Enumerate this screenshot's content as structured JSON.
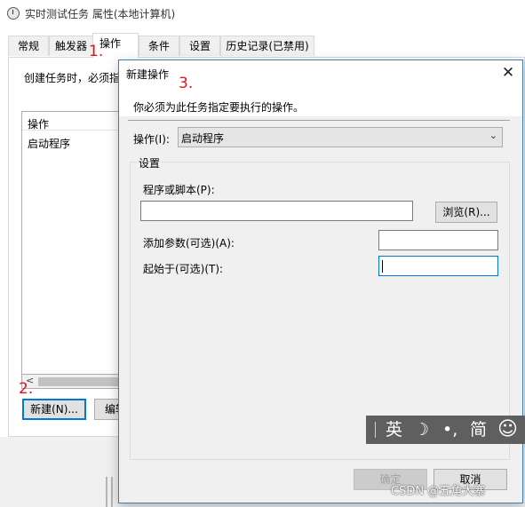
{
  "background_window": {
    "title": "实时测试任务 属性(本地计算机)",
    "tabs": [
      "常规",
      "触发器",
      "操作",
      "条件",
      "设置",
      "历史记录(已禁用)"
    ],
    "active_tab": "操作",
    "instruction": "创建任务时，必须指",
    "list_header": "操作",
    "list_row": "启动程序",
    "new_button": "新建(N)...",
    "edit_button": "编辑"
  },
  "annotations": [
    "1.",
    "2.",
    "3."
  ],
  "dialog": {
    "title": "新建操作",
    "instruction": "你必须为此任务指定要执行的操作。",
    "action_label": "操作(I):",
    "action_value": "启动程序",
    "settings_group": "设置",
    "program_label": "程序或脚本(P):",
    "program_value": "",
    "browse_button": "浏览(R)...",
    "args_label": "添加参数(可选)(A):",
    "args_value": "",
    "start_label": "起始于(可选)(T):",
    "start_value": "",
    "ok_button": "确定",
    "cancel_button": "取消"
  },
  "ime_toolbar": {
    "mode": "英",
    "moon": "☽",
    "punct": "•,",
    "script": "简",
    "emoji": "☺"
  },
  "watermark": "CSDN @五角大寨",
  "icons": [
    "task-clock-icon",
    "close-icon",
    "chevron-down-icon",
    "scroll-left-icon"
  ]
}
